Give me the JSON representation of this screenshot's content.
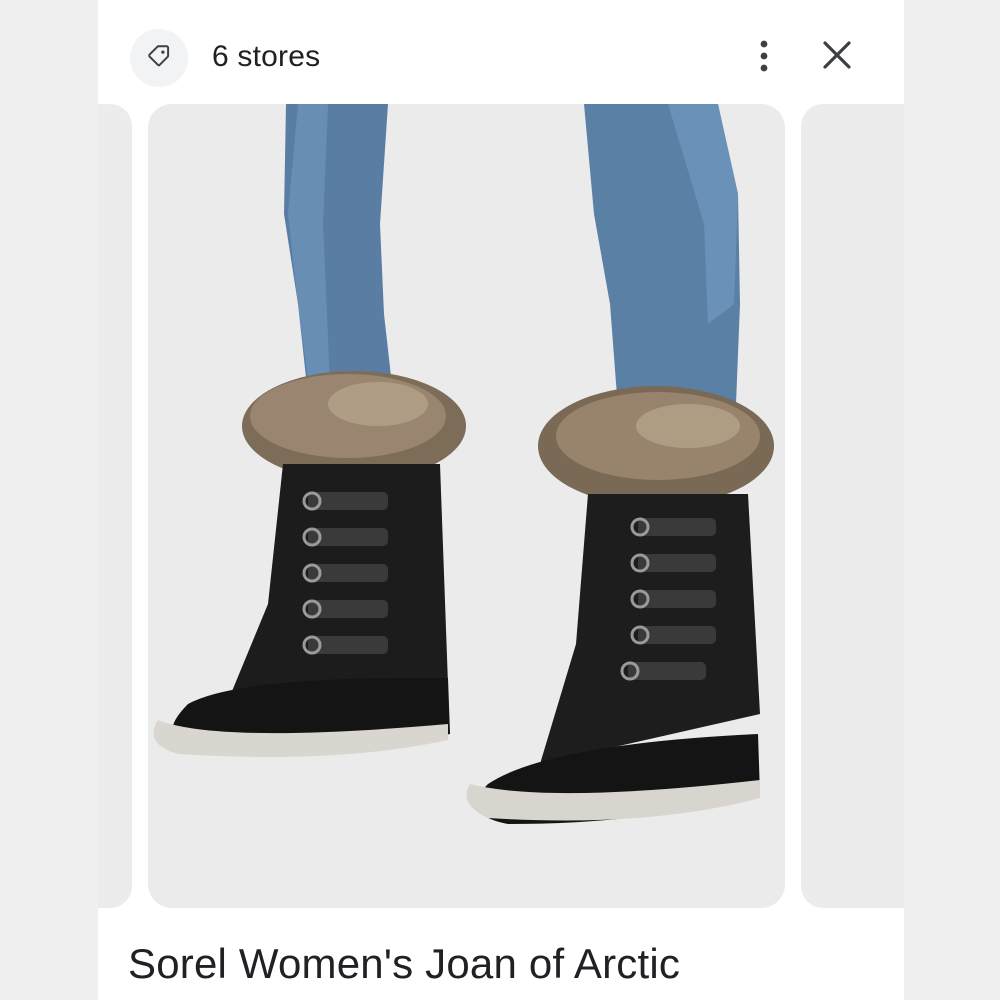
{
  "header": {
    "stores_label": "6 stores",
    "tag_icon": "tag-icon",
    "more_icon": "more-vert-icon",
    "close_icon": "close-icon"
  },
  "carousel": {
    "image_subject": "black winter boots with fur trim"
  },
  "product": {
    "title": "Sorel Women's Joan of Arctic"
  },
  "colors": {
    "text": "#202124",
    "icon_bg": "#f1f3f4",
    "card_bg": "#ebebeb"
  }
}
